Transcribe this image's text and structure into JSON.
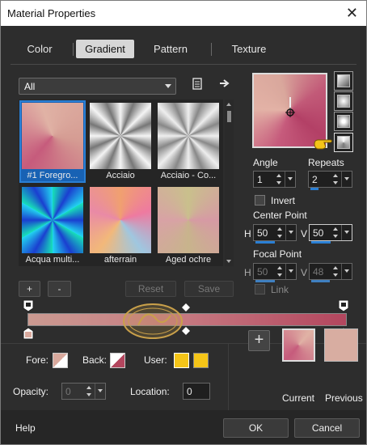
{
  "window": {
    "title": "Material Properties",
    "close": "✕"
  },
  "tabs": [
    {
      "label": "Color"
    },
    {
      "label": "Gradient",
      "active": true
    },
    {
      "label": "Pattern"
    },
    {
      "label": "Texture"
    }
  ],
  "category": {
    "value": "All"
  },
  "gradients": [
    {
      "label": "#1 Foregro...",
      "colors": [
        "#c65b7c",
        "#e0b2a5"
      ],
      "selected": true
    },
    {
      "label": "Acciaio",
      "colors": [
        "#f2f2f2",
        "#6d6d6d"
      ]
    },
    {
      "label": "Acciaio - Co...",
      "colors": [
        "#e8e8e8",
        "#777777"
      ]
    },
    {
      "label": "Acqua multi...",
      "colors": [
        "#17d0a8",
        "#1a57c7"
      ]
    },
    {
      "label": "afterrain",
      "colors": [
        "#ee8a87",
        "#7fbfdf"
      ]
    },
    {
      "label": "Aged ochre",
      "colors": [
        "#c8c08f",
        "#d99aa3"
      ]
    }
  ],
  "list_buttons": {
    "add": "+",
    "remove": "-",
    "reset": "Reset",
    "save": "Save"
  },
  "angle": {
    "label": "Angle",
    "value": "1"
  },
  "repeats": {
    "label": "Repeats",
    "value": "2"
  },
  "invert": {
    "label": "Invert"
  },
  "center_point": {
    "label": "Center Point",
    "h_label": "H",
    "h": "50",
    "v_label": "V",
    "v": "50"
  },
  "focal_point": {
    "label": "Focal Point",
    "h_label": "H",
    "h": "50",
    "v_label": "V",
    "v": "48"
  },
  "link": {
    "label": "Link"
  },
  "stops": {
    "fore": "Fore:",
    "back": "Back:",
    "user": "User:",
    "fore_color": "#d9a99d",
    "back_color": "#b3465e",
    "user_color": "#f5c518"
  },
  "opacity": {
    "label": "Opacity:",
    "value": "0"
  },
  "location": {
    "label": "Location:",
    "value": "0"
  },
  "swatches": {
    "add": "+",
    "current": "Current",
    "previous": "Previous"
  },
  "footer": {
    "help": "Help",
    "ok": "OK",
    "cancel": "Cancel"
  }
}
